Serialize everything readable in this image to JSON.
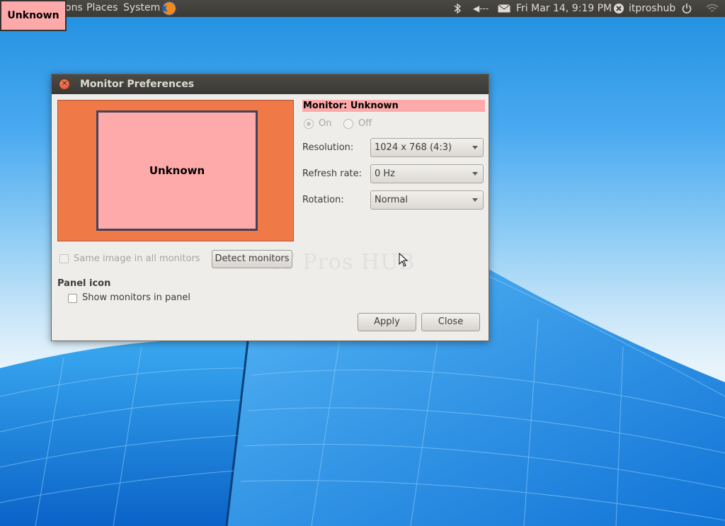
{
  "panel": {
    "menu_applications": "ons",
    "menu_places": "Places",
    "menu_system": "System",
    "datetime": "Fri Mar 14,  9:19 PM",
    "username": "itproshub",
    "volume_text": "◀---"
  },
  "overlay_label": "Unknown",
  "dialog": {
    "title": "Monitor Preferences",
    "monitor_box_label": "Unknown",
    "monitor_header": "Monitor: Unknown",
    "radio_on": "On",
    "radio_off": "Off",
    "resolution_label": "Resolution:",
    "resolution_value": "1024 x 768 (4:3)",
    "refresh_label": "Refresh rate:",
    "refresh_value": "0 Hz",
    "rotation_label": "Rotation:",
    "rotation_value": "Normal",
    "same_image_label": "Same image in all monitors",
    "detect_button": "Detect monitors",
    "panel_icon_heading": "Panel icon",
    "show_monitors_label": "Show monitors in panel",
    "apply_button": "Apply",
    "close_button": "Close",
    "watermark": "IT Pros HUB"
  },
  "colors": {
    "monitor_area": "#ef7a48",
    "monitor_box": "#ffaaaa",
    "panel_bg": "#3b3a36"
  }
}
